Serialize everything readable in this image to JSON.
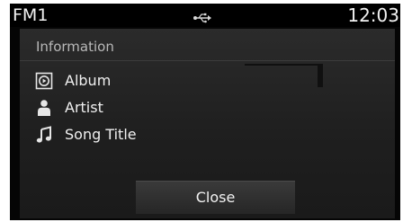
{
  "status_bar": {
    "mode": "FM1",
    "usb_icon": "usb-icon",
    "time": "12:03"
  },
  "panel": {
    "title": "Information",
    "rows": [
      {
        "icon": "album-icon",
        "label": "Album"
      },
      {
        "icon": "artist-icon",
        "label": "Artist"
      },
      {
        "icon": "music-note-icon",
        "label": "Song Title"
      }
    ],
    "close_label": "Close"
  },
  "colors": {
    "screen_background": "#050505",
    "panel_background": "#262626",
    "text_primary": "#f0f0f0",
    "text_secondary": "#b9b9b9"
  }
}
